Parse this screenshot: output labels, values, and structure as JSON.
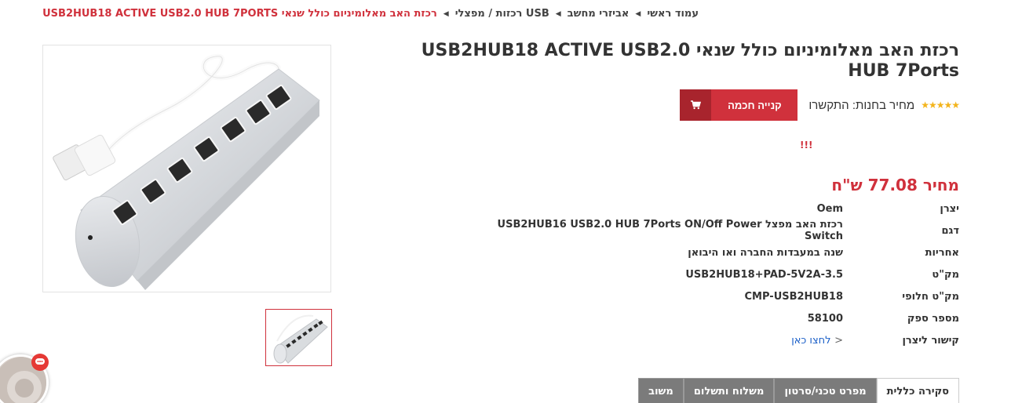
{
  "breadcrumb": {
    "items": [
      "עמוד ראשי",
      "אביזרי מחשב",
      "USB רכזות / מפצלי",
      "רכזת האב מאלומיניום כולל שנאי USB2HUB18 ACTIVE USB2.0 HUB 7PORTS"
    ]
  },
  "product": {
    "title": "רכזת האב מאלומיניום כולל שנאי USB2HUB18 ACTIVE USB2.0 HUB 7Ports",
    "stars": "★★★★★",
    "store_price": "מחיר בחנות: התקשרו",
    "buy_label": "קנייה חכמה",
    "alert": "!!!",
    "price": "מחיר 77.08 ש\"ח"
  },
  "specs": [
    {
      "label": "יצרן",
      "value": "Oem"
    },
    {
      "label": "דגם",
      "value": "רכזת האב מפצל USB2HUB16 USB2.0 HUB 7Ports ON/Off Power Switch"
    },
    {
      "label": "אחריות",
      "value": "שנה במעבדות החברה ואו היבואן"
    },
    {
      "label": "מק\"ט",
      "value": "USB2HUB18+PAD-5V2A-3.5"
    },
    {
      "label": "מק\"ט חלופי",
      "value": "CMP-USB2HUB18"
    },
    {
      "label": "מספר ספק",
      "value": "58100"
    },
    {
      "label": "קישור ליצרן",
      "value": "לחצו כאן",
      "prefix": "<"
    }
  ],
  "tabs": [
    "סקירה כללית",
    "מפרט טכני/סרטון",
    "משלוח ותשלום",
    "משוב"
  ],
  "colors": {
    "accent": "#d0313c",
    "accent_dark": "#a8242d",
    "star": "#f3b41b",
    "link": "#1a5fc8",
    "tab_inactive": "#7b7b7b"
  },
  "icons": [
    "cart-icon",
    "chevron-left-icon",
    "chat-icon",
    "usb-hub-product-image"
  ]
}
